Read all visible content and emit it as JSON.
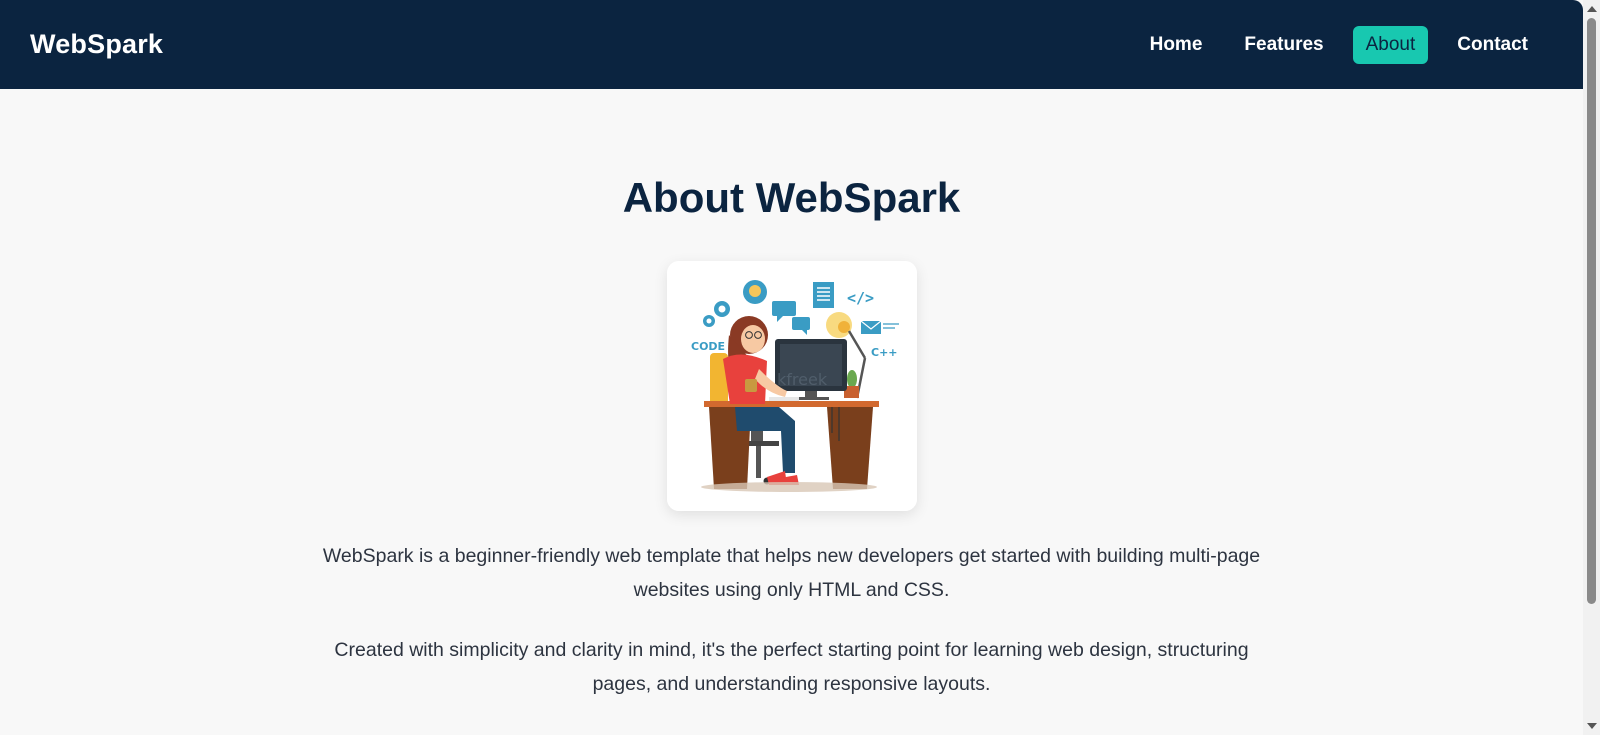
{
  "nav": {
    "brand": "WebSpark",
    "links": [
      {
        "label": "Home",
        "active": false
      },
      {
        "label": "Features",
        "active": false
      },
      {
        "label": "About",
        "active": true
      },
      {
        "label": "Contact",
        "active": false
      }
    ]
  },
  "main": {
    "title": "About WebSpark",
    "illustration": {
      "labels": {
        "code": "CODE",
        "cpp": "C++",
        "tag": "</>",
        "watermark": "kfreek"
      }
    },
    "paragraphs": [
      "WebSpark is a beginner-friendly web template that helps new developers get started with building multi-page websites using only HTML and CSS.",
      "Created with simplicity and clarity in mind, it's the perfect starting point for learning web design, structuring pages, and understanding responsive layouts."
    ]
  },
  "colors": {
    "navbar_bg": "#0b2440",
    "accent": "#18c8b0",
    "page_bg": "#f8f8f8",
    "title": "#0b2440"
  }
}
